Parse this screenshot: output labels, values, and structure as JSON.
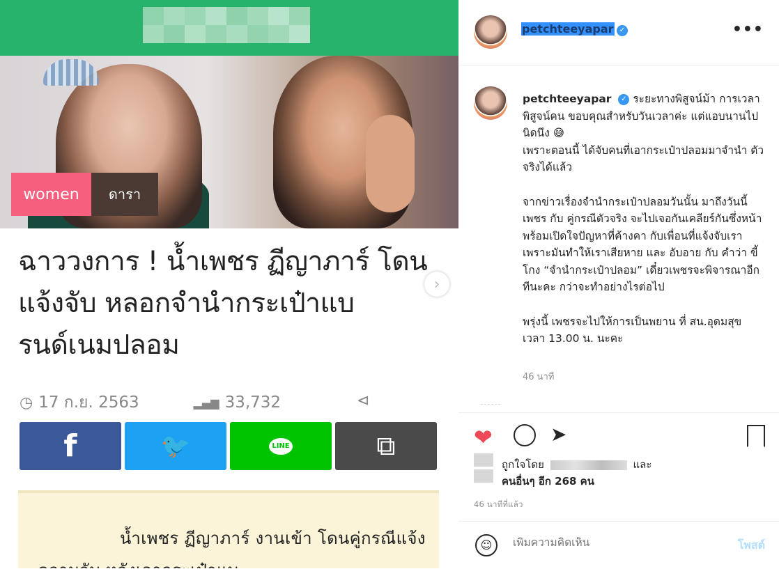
{
  "article": {
    "tag_primary": "women",
    "tag_secondary": "ดารา",
    "headline": "ฉาววงการ ! น้ำเพชร ฏีญาภาร์ โดนแจ้งจับ หลอกจำนำกระเป๋าแบรนด์เนมปลอม",
    "date": "17 ก.ย. 2563",
    "views": "33,732",
    "share_buttons": {
      "facebook": "f",
      "line": "LINE"
    },
    "body": "น้ำเพชร ฏีญาภาร์ งานเข้า โดนคู่กรณีแจ้งความจับ หลังเอากระเป๋าแบ"
  },
  "post": {
    "username": "petchteeyapar",
    "caption_lines": [
      "ระยะทางพิสูจน์ม้า การเวลาพิสูจน์คน ขอบคุณสำหรับวันเวลาค่ะ แต่แอบนานไปนิดนึง 😅",
      "เพราะตอนนี้ ได้จับคนที่เอากระเป๋าปลอมมาจำนำ ตัวจริงได้แล้ว"
    ],
    "caption_para2": "จากข่าวเรื่องจำนำกระเป๋าปลอมวันนั้น มาถึงวันนี้ เพชร กับ คู่กรณีตัวจริง จะไปเจอกันเคลียร์กันซึ่งหน้า พร้อมเปิดใจปัญหาที่ค้างคา กับเพื่อนที่แจ้งจับเรา เพราะมันทำให้เราเสียหาย และ อับอาย กับ คำว่า ขี้โกง “จำนำกระเป๋าปลอม” เดี๋ยวเพชรจะพิจารณาอีกทีนะคะ กว่าจะทำอย่างไรต่อไป",
    "caption_para3": "พรุ่งนี้ เพชรจะไปให้การเป็นพยาน ที่ สน.อุดมสุข เวลา 13.00 น. นะคะ",
    "caption_time": "46 นาที",
    "likes_prefix": "ถูกใจโดย",
    "likes_and": "และ",
    "likes_others": "คนอื่นๆ อีก 268 คน",
    "post_time": "46 นาทีที่แล้ว",
    "comment_placeholder": "เพิ่มความคิดเห็น",
    "post_button": "โพสต์"
  },
  "colors": {
    "top_bar": "#27b36b",
    "tag_women": "#f6607e",
    "facebook": "#3b5998",
    "twitter": "#1da1f2",
    "line": "#00c300",
    "heart": "#ed4956",
    "verified": "#3897f0"
  },
  "icons": [
    "clock-icon",
    "chart-icon",
    "share-icon",
    "chevron-right-icon",
    "heart-icon",
    "comment-icon",
    "send-icon",
    "bookmark-icon",
    "emoji-icon",
    "more-icon",
    "verified-icon",
    "twitter-icon",
    "copy-icon"
  ]
}
